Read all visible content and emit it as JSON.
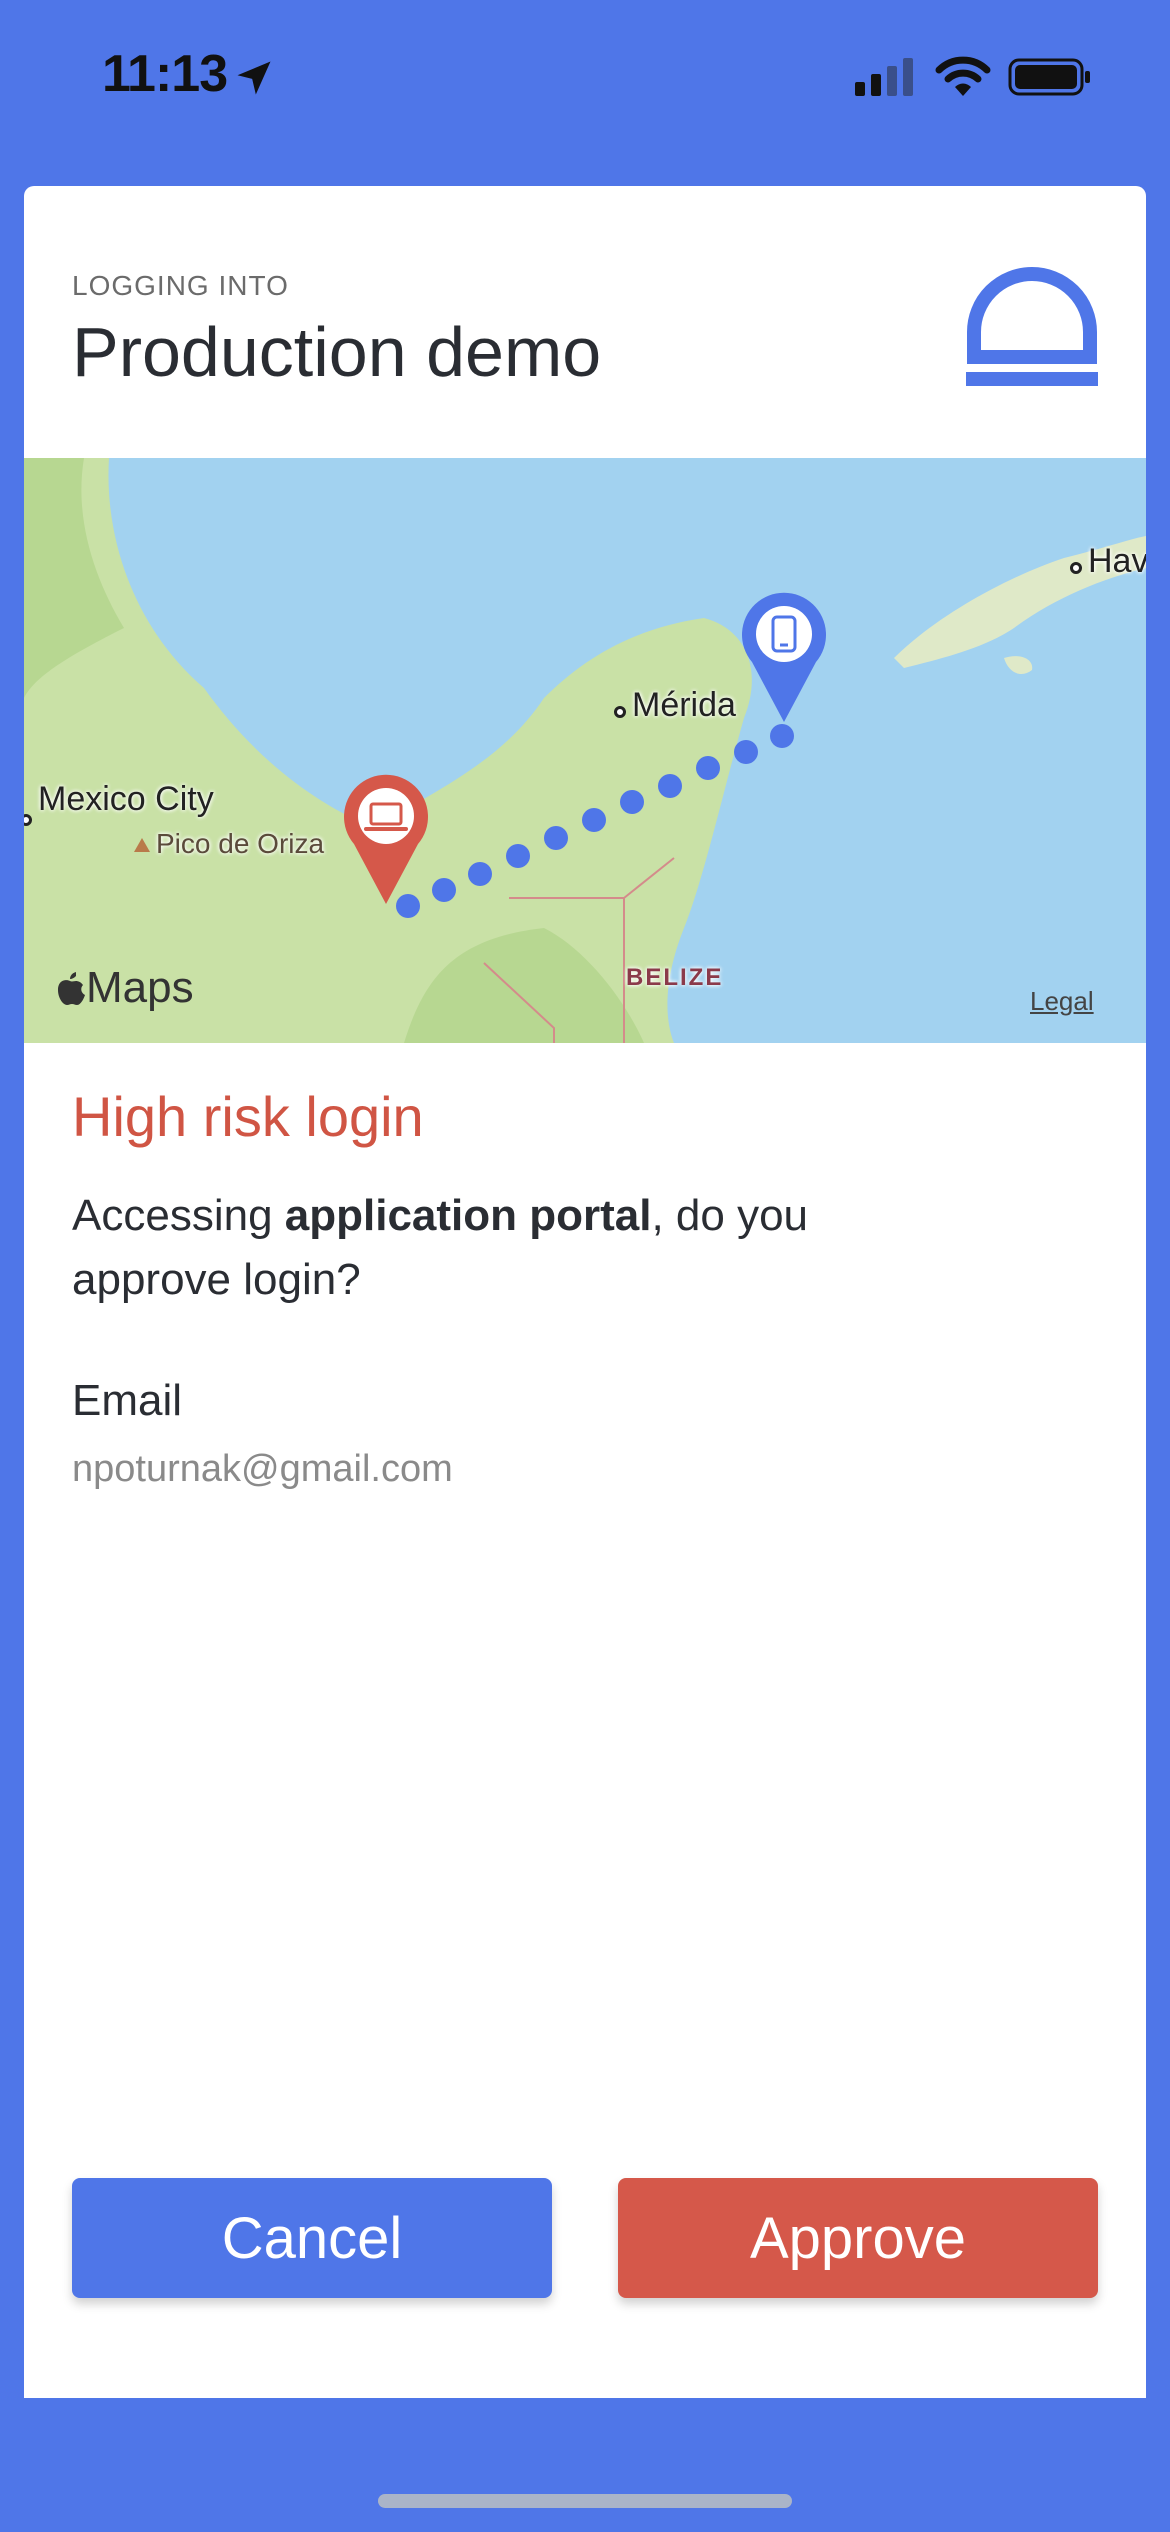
{
  "status_bar": {
    "time": "11:13"
  },
  "header": {
    "eyebrow": "LOGGING INTO",
    "title": "Production demo"
  },
  "map": {
    "labels": {
      "havana": "Hav",
      "merida": "Mérida",
      "mexico_city": "Mexico City",
      "pico": "Pico de Oriza",
      "belize": "BELIZE"
    },
    "attribution": "Maps",
    "legal": "Legal",
    "colors": {
      "phone_pin": "#4f76e8",
      "laptop_pin": "#d5584a",
      "path": "#4f76e8"
    }
  },
  "risk": {
    "title": "High risk login",
    "prompt_prefix": "Accessing ",
    "prompt_bold": "application portal",
    "prompt_suffix": ", do you approve login?"
  },
  "email": {
    "label": "Email",
    "value": "npoturnak@gmail.com"
  },
  "actions": {
    "cancel_label": "Cancel",
    "approve_label": "Approve"
  },
  "colors": {
    "accent": "#4f76e8",
    "danger": "#d5584a"
  }
}
